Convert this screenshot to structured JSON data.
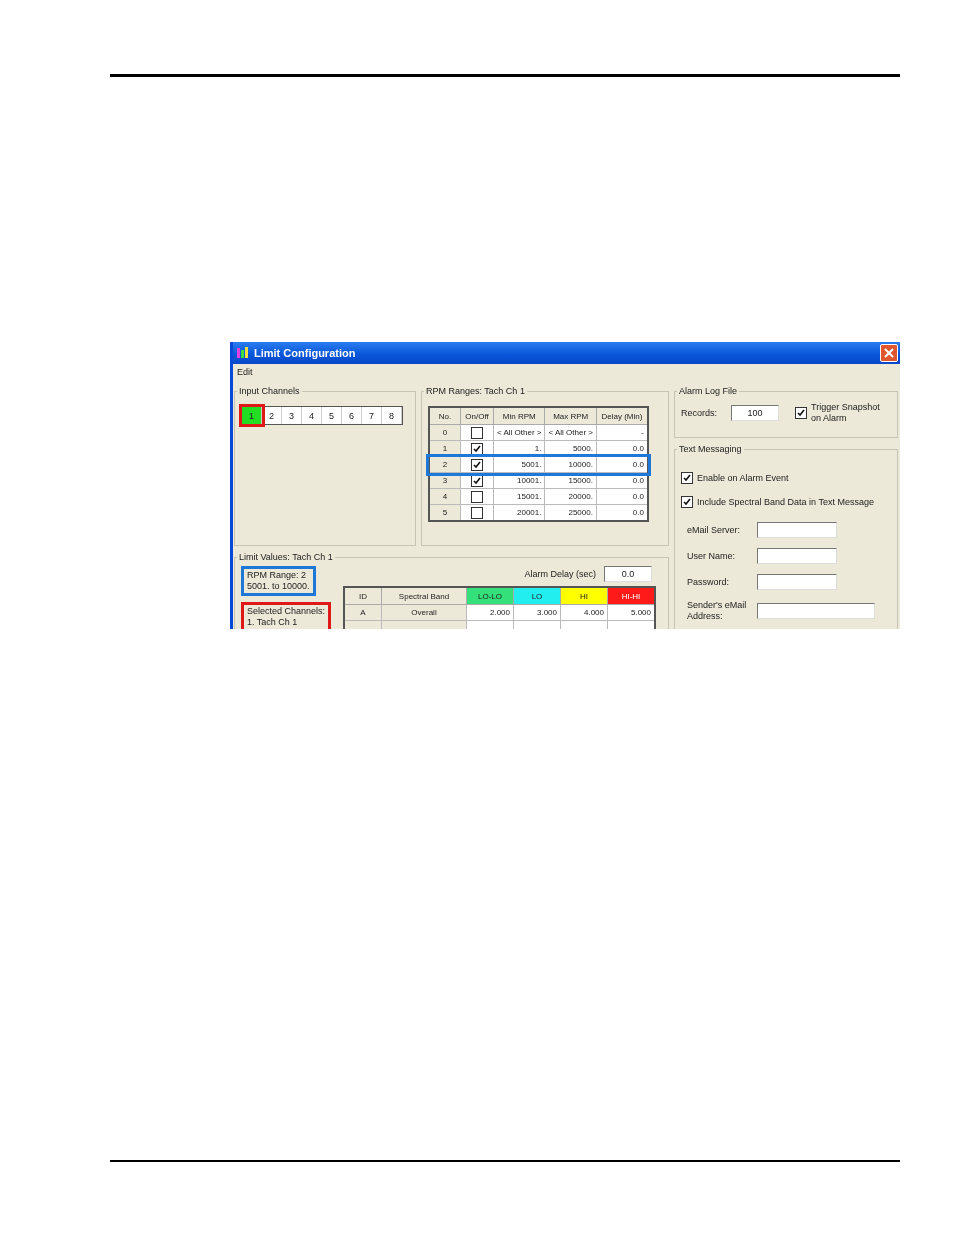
{
  "window": {
    "title": "Limit Configuration",
    "menu": [
      "Edit"
    ]
  },
  "input_channels": {
    "title": "Input Channels",
    "channels": [
      {
        "label": "1",
        "selected": true
      },
      {
        "label": "2",
        "selected": false
      },
      {
        "label": "3",
        "selected": false
      },
      {
        "label": "4",
        "selected": false
      },
      {
        "label": "5",
        "selected": false
      },
      {
        "label": "6",
        "selected": false
      },
      {
        "label": "7",
        "selected": false
      },
      {
        "label": "8",
        "selected": false
      }
    ]
  },
  "rpm_ranges": {
    "title": "RPM Ranges:  Tach Ch  1",
    "columns": [
      "No.",
      "On/Off",
      "Min RPM",
      "Max RPM",
      "Delay (Min)"
    ],
    "rows": [
      {
        "no": "0",
        "checked": false,
        "min": "< All Other >",
        "max": "< All Other >",
        "delay": "-",
        "selected": false
      },
      {
        "no": "1",
        "checked": true,
        "min": "1.",
        "max": "5000.",
        "delay": "0.0",
        "selected": false
      },
      {
        "no": "2",
        "checked": true,
        "min": "5001.",
        "max": "10000.",
        "delay": "0.0",
        "selected": true
      },
      {
        "no": "3",
        "checked": true,
        "min": "10001.",
        "max": "15000.",
        "delay": "0.0",
        "selected": false
      },
      {
        "no": "4",
        "checked": false,
        "min": "15001.",
        "max": "20000.",
        "delay": "0.0",
        "selected": false
      },
      {
        "no": "5",
        "checked": false,
        "min": "20001.",
        "max": "25000.",
        "delay": "0.0",
        "selected": false
      }
    ]
  },
  "limit_values": {
    "title": "Limit Values:   Tach Ch  1",
    "info_boxes": [
      {
        "lines": [
          "RPM Range: 2",
          "5001. to 10000."
        ],
        "color": "#1e78d8"
      },
      {
        "lines": [
          "Selected Channels:",
          "1. Tach Ch  1"
        ],
        "color": "#e01818"
      }
    ],
    "alarm_delay": {
      "label": "Alarm Delay (sec)",
      "value": "0.0"
    },
    "columns": [
      {
        "label": "ID"
      },
      {
        "label": "Spectral Band"
      },
      {
        "label": "LO-LO",
        "color": "#33e07a"
      },
      {
        "label": "LO",
        "color": "#22eef0"
      },
      {
        "label": "HI",
        "color": "#ffff00"
      },
      {
        "label": "HI-HI",
        "color": "#ff1a1a"
      }
    ],
    "rows": [
      [
        "A",
        "Overall",
        "2.000",
        "3.000",
        "4.000",
        "5.000"
      ]
    ]
  },
  "alarm_log": {
    "title": "Alarm Log File",
    "records_label": "Records:",
    "records_value": "100",
    "trigger": {
      "label": "Trigger Snapshot on Alarm",
      "checked": true
    }
  },
  "text_messaging": {
    "title": "Text Messaging",
    "options": [
      {
        "label": "Enable on Alarm Event",
        "checked": true
      },
      {
        "label": "Include Spectral Band Data in Text Message",
        "checked": true
      }
    ],
    "fields": [
      {
        "label": "eMail Server:",
        "wide": false
      },
      {
        "label": "User Name:",
        "wide": false
      },
      {
        "label": "Password:",
        "wide": false
      },
      {
        "label": "Sender's eMail Address:",
        "wide": true
      }
    ]
  }
}
